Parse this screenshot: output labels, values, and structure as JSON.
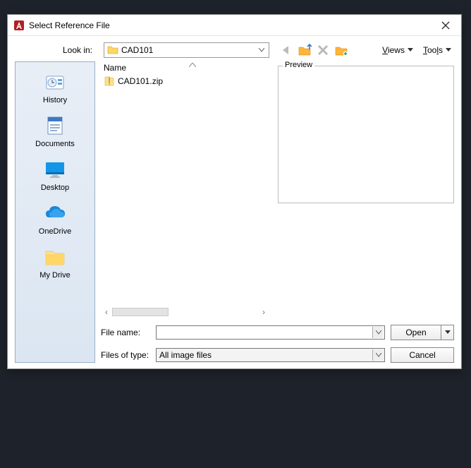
{
  "title": "Select Reference File",
  "lookin_label": "Look in:",
  "lookin_value": "CAD101",
  "menus": {
    "views": "Views",
    "tools": "Tools"
  },
  "columns": {
    "name": "Name"
  },
  "files": [
    {
      "name": "CAD101.zip"
    }
  ],
  "preview_label": "Preview",
  "filename_label": "File name:",
  "filename_value": "",
  "filetype_label": "Files of type:",
  "filetype_value": "All image files",
  "buttons": {
    "open": "Open",
    "cancel": "Cancel"
  },
  "places": [
    {
      "key": "history",
      "label": "History"
    },
    {
      "key": "documents",
      "label": "Documents"
    },
    {
      "key": "desktop",
      "label": "Desktop"
    },
    {
      "key": "onedrive",
      "label": "OneDrive"
    },
    {
      "key": "mydrive",
      "label": "My Drive"
    }
  ]
}
